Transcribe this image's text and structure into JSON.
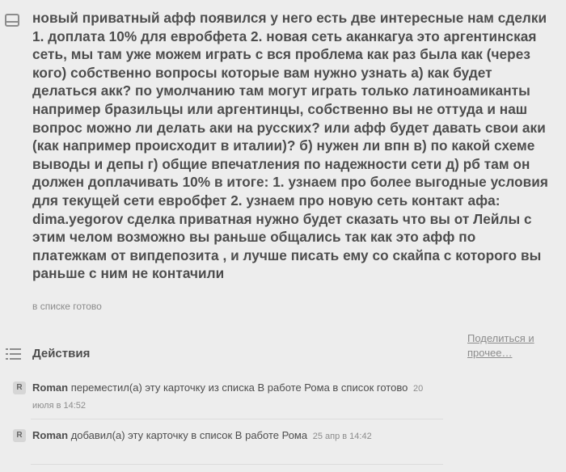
{
  "card": {
    "description": "новый приватный афф появился у него есть две интересные нам сделки 1. доплата 10% для евробфета 2. новая сеть аканкагуа это аргентинская сеть, мы там уже можем играть с вся проблема как раз была как (через кого) собственно вопросы которые вам нужно узнать а) как будет делаться акк? по умолчанию там могут играть только латиноамиканты например бразильцы или аргентинцы, собственно вы не оттуда и наш вопрос можно ли делать аки на русских? или афф будет давать свои аки (как например происходит в италии)? б) нужен ли впн в) по какой схеме выводы и депы г) общие впечатления по надежности сети д) рб там он должен доплачивать 10% в итоге: 1. узнаем про более выгодные условия для текущей сети евробфет 2. узнаем про новую сеть контакт афа: dima.yegorov сделка приватная нужно будет сказать что вы от Лейлы с этим челом возможно вы раньше общались так как это афф по платежкам от випдепозита , и лучше писать ему со скайпа с которого вы раньше с ним не контачили",
    "in_list": "в списке готово"
  },
  "activity": {
    "title": "Действия",
    "share_label": "Поделиться и прочее…",
    "items": [
      {
        "avatar": "R",
        "author": "Roman",
        "text": "переместил(а) эту карточку из списка В работе Рома в список готово",
        "date": "20 июля в 14:52"
      },
      {
        "avatar": "R",
        "author": "Roman",
        "text": "добавил(а) эту карточку в список В работе Рома",
        "date": "25 апр в 14:42"
      }
    ]
  },
  "icons": {
    "card": "card-icon",
    "activity": "list-icon"
  },
  "colors": {
    "background": "#ededed",
    "text": "#4d4d4d",
    "muted": "#8c8c8c"
  }
}
